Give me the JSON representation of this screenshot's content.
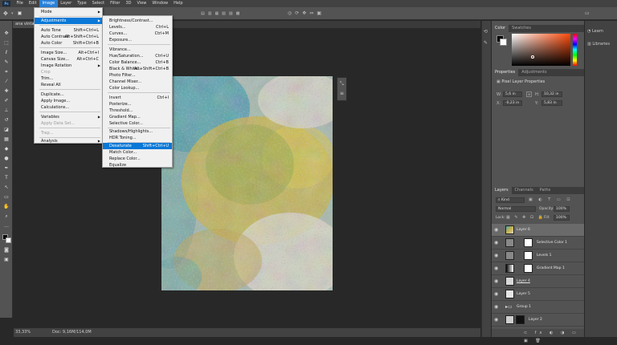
{
  "menubar": {
    "items": [
      "File",
      "Edit",
      "Image",
      "Layer",
      "Type",
      "Select",
      "Filter",
      "3D",
      "View",
      "Window",
      "Help"
    ],
    "active": "Image",
    "logo": "Ps"
  },
  "tab": {
    "name": "ana vintage"
  },
  "image_menu": {
    "items": [
      {
        "label": "Mode",
        "shortcut": "",
        "submenu": true
      },
      {
        "label": "Adjustments",
        "shortcut": "",
        "submenu": true,
        "highlighted": true
      },
      {
        "label": "Auto Tone",
        "shortcut": "Shift+Ctrl+L"
      },
      {
        "label": "Auto Contrast",
        "shortcut": "Alt+Shift+Ctrl+L"
      },
      {
        "label": "Auto Color",
        "shortcut": "Shift+Ctrl+B"
      },
      {
        "label": "Image Size...",
        "shortcut": "Alt+Ctrl+I"
      },
      {
        "label": "Canvas Size...",
        "shortcut": "Alt+Ctrl+C"
      },
      {
        "label": "Image Rotation",
        "shortcut": "",
        "submenu": true
      },
      {
        "label": "Crop",
        "shortcut": "",
        "disabled": true
      },
      {
        "label": "Trim...",
        "shortcut": ""
      },
      {
        "label": "Reveal All",
        "shortcut": ""
      },
      {
        "label": "Duplicate...",
        "shortcut": ""
      },
      {
        "label": "Apply Image...",
        "shortcut": ""
      },
      {
        "label": "Calculations...",
        "shortcut": ""
      },
      {
        "label": "Variables",
        "shortcut": "",
        "submenu": true
      },
      {
        "label": "Apply Data Set...",
        "shortcut": "",
        "disabled": true
      },
      {
        "label": "Trap...",
        "shortcut": "",
        "disabled": true
      },
      {
        "label": "Analysis",
        "shortcut": "",
        "submenu": true
      }
    ]
  },
  "adjust_menu": {
    "items": [
      {
        "label": "Brightness/Contrast...",
        "shortcut": ""
      },
      {
        "label": "Levels...",
        "shortcut": "Ctrl+L"
      },
      {
        "label": "Curves...",
        "shortcut": "Ctrl+M"
      },
      {
        "label": "Exposure...",
        "shortcut": ""
      },
      {
        "label": "Vibrance...",
        "shortcut": ""
      },
      {
        "label": "Hue/Saturation...",
        "shortcut": "Ctrl+U"
      },
      {
        "label": "Color Balance...",
        "shortcut": "Ctrl+B"
      },
      {
        "label": "Black & White...",
        "shortcut": "Alt+Shift+Ctrl+B"
      },
      {
        "label": "Photo Filter...",
        "shortcut": ""
      },
      {
        "label": "Channel Mixer...",
        "shortcut": ""
      },
      {
        "label": "Color Lookup...",
        "shortcut": ""
      },
      {
        "label": "Invert",
        "shortcut": "Ctrl+I"
      },
      {
        "label": "Posterize...",
        "shortcut": ""
      },
      {
        "label": "Threshold...",
        "shortcut": ""
      },
      {
        "label": "Gradient Map...",
        "shortcut": ""
      },
      {
        "label": "Selective Color...",
        "shortcut": ""
      },
      {
        "label": "Shadows/Highlights...",
        "shortcut": ""
      },
      {
        "label": "HDR Toning...",
        "shortcut": ""
      },
      {
        "label": "Desaturate",
        "shortcut": "Shift+Ctrl+U",
        "highlighted": true
      },
      {
        "label": "Match Color...",
        "shortcut": ""
      },
      {
        "label": "Replace Color...",
        "shortcut": ""
      },
      {
        "label": "Equalize",
        "shortcut": ""
      }
    ]
  },
  "status": {
    "zoom": "33,33%",
    "doc": "Doc: 9,16M/114,0M"
  },
  "color_panel": {
    "tabs": [
      "Color",
      "Swatches"
    ]
  },
  "properties": {
    "tabs": [
      "Properties",
      "Adjustments"
    ],
    "title": "Pixel Layer Properties",
    "w": "5,6 in",
    "h": "10,32 in",
    "x": "-0,23 in",
    "y": "5,83 in"
  },
  "layers_panel": {
    "tabs": [
      "Layers",
      "Channels",
      "Paths"
    ],
    "kind": "Kind",
    "blend": "Normal",
    "opacity_label": "Opacity:",
    "opacity": "100%",
    "lock_label": "Lock:",
    "fill_label": "Fill:",
    "fill": "100%",
    "layers": [
      {
        "name": "Layer 6",
        "selected": true
      },
      {
        "name": "Selective Color 1"
      },
      {
        "name": "Levels 1"
      },
      {
        "name": "Gradient Map 1"
      },
      {
        "name": "Layer 4"
      },
      {
        "name": "Layer 5"
      },
      {
        "name": "Group 1"
      },
      {
        "name": "Layer 2"
      }
    ]
  },
  "libraries": {
    "learn": "Learn",
    "libraries": "Libraries"
  },
  "colors": {
    "accent": "#2a82da",
    "highlight": "#0a78d7",
    "fg": "#000000",
    "bg": "#ffffff"
  }
}
